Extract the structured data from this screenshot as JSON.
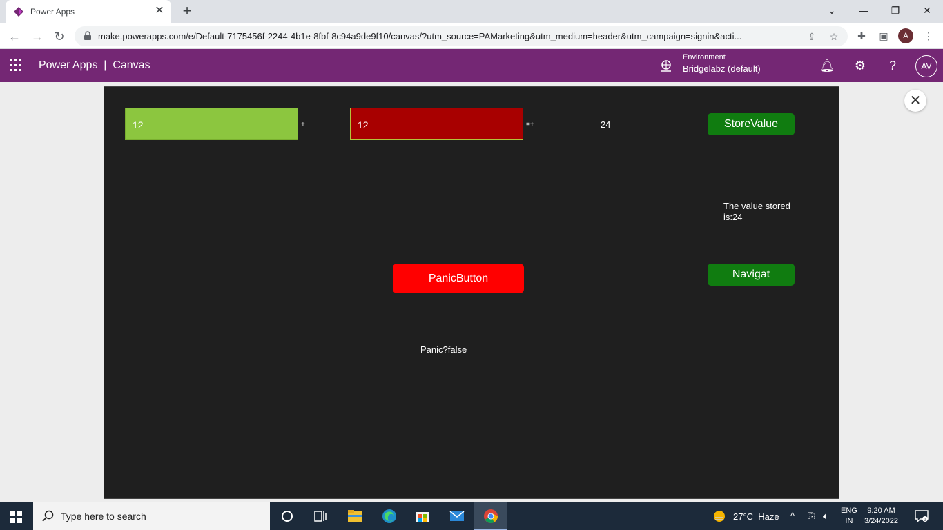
{
  "browser": {
    "tab_title": "Power Apps",
    "tab_close": "✕",
    "new_tab": "+",
    "url": "make.powerapps.com/e/Default-7175456f-2244-4b1e-8fbf-8c94a9de9f10/canvas/?utm_source=PAMarketing&utm_medium=header&utm_campaign=signin&acti...",
    "profile_initial": "A"
  },
  "header": {
    "title": "Power Apps  |  Canvas",
    "environment_label": "Environment",
    "environment_value": "Bridgelabz (default)",
    "user_initials": "AV"
  },
  "app": {
    "input1_value": "12",
    "plus_operator": "+",
    "input2_value": "12",
    "equals_operator": "=+",
    "result_value": "24",
    "store_button": "StoreValue",
    "stored_label": "The value stored is:24",
    "panic_button": "PanicButton",
    "navigate_button": "Navigat",
    "panic_status": "Panic?false"
  },
  "taskbar": {
    "search_placeholder": "Type here to search",
    "weather": "27°C  Haze",
    "lang_1": "ENG",
    "lang_2": "IN",
    "time": "9:20 AM",
    "date": "3/24/2022"
  },
  "colors": {
    "header_purple": "#742774",
    "input1_green": "#8cc63f",
    "input2_red": "#a80000",
    "button_green": "#107c10",
    "panic_red": "#ff0000",
    "canvas_bg": "#1f1f1f"
  }
}
